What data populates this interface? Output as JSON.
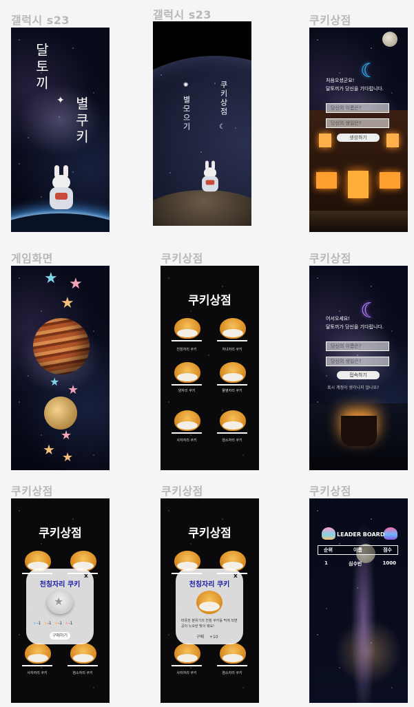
{
  "frames": {
    "f1": {
      "label": "갤럭시 s23",
      "title_word1": "달토끼",
      "title_word2": "별쿠키"
    },
    "f2": {
      "label": "갤럭시 s23",
      "word1": "별모으기",
      "word2": "쿠키상점"
    },
    "f3": {
      "label": "쿠키상점",
      "greeting1": "처음오셨군요!",
      "greeting2": "달토끼가 당신을 기다립니다.",
      "id_placeholder": "당신의 이름은?",
      "pw_placeholder": "당신의 생일은?",
      "button": "생성하기"
    },
    "f4": {
      "label": "게임화면"
    },
    "f5": {
      "label": "쿠키상점",
      "shop_title": "쿠키상점",
      "cookies": [
        "천칭자리 쿠키",
        "처녀자리 쿠키",
        "양자리 쿠키",
        "물병자리 쿠키",
        "사자자리 쿠키",
        "염소자리 쿠키"
      ]
    },
    "f6": {
      "label": "쿠키상점",
      "greeting1": "어서오세요!",
      "greeting2": "달토끼가 당신을 기다립니다.",
      "id_placeholder": "당신의 이름은?",
      "pw_placeholder": "당신의 생일은?",
      "button": "접속하기",
      "forgot": "혹시 계정이 생각나지 않나요?"
    },
    "f7": {
      "label": "쿠키상점",
      "shop_title": "쿠키상점",
      "popup_title": "천칭자리 쿠키",
      "close": "x",
      "costs": [
        "-1",
        "-1",
        "-1",
        "-1"
      ],
      "button": "구매하기",
      "cookies": [
        "사자자리 쿠키",
        "염소자리 쿠키"
      ]
    },
    "f8": {
      "label": "쿠키상점",
      "shop_title": "쿠키상점",
      "popup_title": "천칭자리 쿠키",
      "close": "x",
      "desc1": "따뜻한 분위기의 천칭 쿠키를 먹게 되면",
      "desc2": "공이 노오란 빛이 돼요!",
      "button_left": "구매",
      "button_right": "+10",
      "cookies": [
        "사자자리 쿠키",
        "염소자리 쿠키"
      ]
    },
    "f9": {
      "label": "쿠키상점",
      "title": "LEADER BOARD",
      "col_rank": "순위",
      "col_name": "이름",
      "col_score": "점수",
      "rows": [
        {
          "rank": "1",
          "name": "심수빈",
          "score": "1000"
        }
      ]
    }
  }
}
